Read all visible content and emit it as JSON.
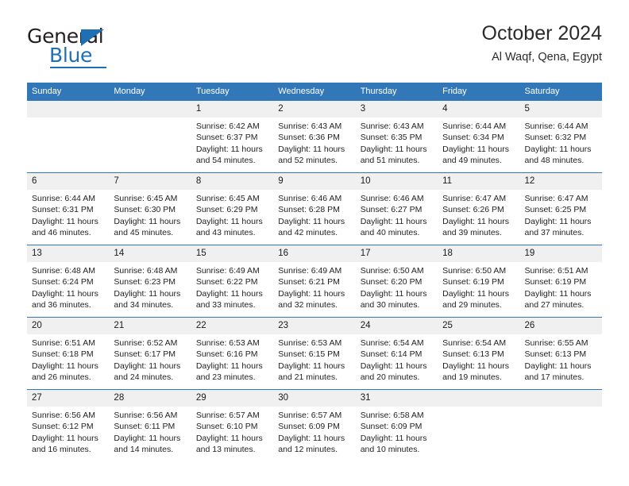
{
  "logo": {
    "word1": "General",
    "word2": "Blue",
    "triangle_color": "#1f6fb5"
  },
  "header": {
    "title": "October 2024",
    "subtitle": "Al Waqf, Qena, Egypt",
    "header_bg": "#3278b8"
  },
  "calendar": {
    "weekday_headers": [
      "Sunday",
      "Monday",
      "Tuesday",
      "Wednesday",
      "Thursday",
      "Friday",
      "Saturday"
    ],
    "labels": {
      "sunrise": "Sunrise:",
      "sunset": "Sunset:",
      "daylight": "Daylight:"
    },
    "weeks": [
      [
        {
          "day": ""
        },
        {
          "day": ""
        },
        {
          "day": "1",
          "sunrise": "Sunrise: 6:42 AM",
          "sunset": "Sunset: 6:37 PM",
          "daylight": "Daylight: 11 hours and 54 minutes."
        },
        {
          "day": "2",
          "sunrise": "Sunrise: 6:43 AM",
          "sunset": "Sunset: 6:36 PM",
          "daylight": "Daylight: 11 hours and 52 minutes."
        },
        {
          "day": "3",
          "sunrise": "Sunrise: 6:43 AM",
          "sunset": "Sunset: 6:35 PM",
          "daylight": "Daylight: 11 hours and 51 minutes."
        },
        {
          "day": "4",
          "sunrise": "Sunrise: 6:44 AM",
          "sunset": "Sunset: 6:34 PM",
          "daylight": "Daylight: 11 hours and 49 minutes."
        },
        {
          "day": "5",
          "sunrise": "Sunrise: 6:44 AM",
          "sunset": "Sunset: 6:32 PM",
          "daylight": "Daylight: 11 hours and 48 minutes."
        }
      ],
      [
        {
          "day": "6",
          "sunrise": "Sunrise: 6:44 AM",
          "sunset": "Sunset: 6:31 PM",
          "daylight": "Daylight: 11 hours and 46 minutes."
        },
        {
          "day": "7",
          "sunrise": "Sunrise: 6:45 AM",
          "sunset": "Sunset: 6:30 PM",
          "daylight": "Daylight: 11 hours and 45 minutes."
        },
        {
          "day": "8",
          "sunrise": "Sunrise: 6:45 AM",
          "sunset": "Sunset: 6:29 PM",
          "daylight": "Daylight: 11 hours and 43 minutes."
        },
        {
          "day": "9",
          "sunrise": "Sunrise: 6:46 AM",
          "sunset": "Sunset: 6:28 PM",
          "daylight": "Daylight: 11 hours and 42 minutes."
        },
        {
          "day": "10",
          "sunrise": "Sunrise: 6:46 AM",
          "sunset": "Sunset: 6:27 PM",
          "daylight": "Daylight: 11 hours and 40 minutes."
        },
        {
          "day": "11",
          "sunrise": "Sunrise: 6:47 AM",
          "sunset": "Sunset: 6:26 PM",
          "daylight": "Daylight: 11 hours and 39 minutes."
        },
        {
          "day": "12",
          "sunrise": "Sunrise: 6:47 AM",
          "sunset": "Sunset: 6:25 PM",
          "daylight": "Daylight: 11 hours and 37 minutes."
        }
      ],
      [
        {
          "day": "13",
          "sunrise": "Sunrise: 6:48 AM",
          "sunset": "Sunset: 6:24 PM",
          "daylight": "Daylight: 11 hours and 36 minutes."
        },
        {
          "day": "14",
          "sunrise": "Sunrise: 6:48 AM",
          "sunset": "Sunset: 6:23 PM",
          "daylight": "Daylight: 11 hours and 34 minutes."
        },
        {
          "day": "15",
          "sunrise": "Sunrise: 6:49 AM",
          "sunset": "Sunset: 6:22 PM",
          "daylight": "Daylight: 11 hours and 33 minutes."
        },
        {
          "day": "16",
          "sunrise": "Sunrise: 6:49 AM",
          "sunset": "Sunset: 6:21 PM",
          "daylight": "Daylight: 11 hours and 32 minutes."
        },
        {
          "day": "17",
          "sunrise": "Sunrise: 6:50 AM",
          "sunset": "Sunset: 6:20 PM",
          "daylight": "Daylight: 11 hours and 30 minutes."
        },
        {
          "day": "18",
          "sunrise": "Sunrise: 6:50 AM",
          "sunset": "Sunset: 6:19 PM",
          "daylight": "Daylight: 11 hours and 29 minutes."
        },
        {
          "day": "19",
          "sunrise": "Sunrise: 6:51 AM",
          "sunset": "Sunset: 6:19 PM",
          "daylight": "Daylight: 11 hours and 27 minutes."
        }
      ],
      [
        {
          "day": "20",
          "sunrise": "Sunrise: 6:51 AM",
          "sunset": "Sunset: 6:18 PM",
          "daylight": "Daylight: 11 hours and 26 minutes."
        },
        {
          "day": "21",
          "sunrise": "Sunrise: 6:52 AM",
          "sunset": "Sunset: 6:17 PM",
          "daylight": "Daylight: 11 hours and 24 minutes."
        },
        {
          "day": "22",
          "sunrise": "Sunrise: 6:53 AM",
          "sunset": "Sunset: 6:16 PM",
          "daylight": "Daylight: 11 hours and 23 minutes."
        },
        {
          "day": "23",
          "sunrise": "Sunrise: 6:53 AM",
          "sunset": "Sunset: 6:15 PM",
          "daylight": "Daylight: 11 hours and 21 minutes."
        },
        {
          "day": "24",
          "sunrise": "Sunrise: 6:54 AM",
          "sunset": "Sunset: 6:14 PM",
          "daylight": "Daylight: 11 hours and 20 minutes."
        },
        {
          "day": "25",
          "sunrise": "Sunrise: 6:54 AM",
          "sunset": "Sunset: 6:13 PM",
          "daylight": "Daylight: 11 hours and 19 minutes."
        },
        {
          "day": "26",
          "sunrise": "Sunrise: 6:55 AM",
          "sunset": "Sunset: 6:13 PM",
          "daylight": "Daylight: 11 hours and 17 minutes."
        }
      ],
      [
        {
          "day": "27",
          "sunrise": "Sunrise: 6:56 AM",
          "sunset": "Sunset: 6:12 PM",
          "daylight": "Daylight: 11 hours and 16 minutes."
        },
        {
          "day": "28",
          "sunrise": "Sunrise: 6:56 AM",
          "sunset": "Sunset: 6:11 PM",
          "daylight": "Daylight: 11 hours and 14 minutes."
        },
        {
          "day": "29",
          "sunrise": "Sunrise: 6:57 AM",
          "sunset": "Sunset: 6:10 PM",
          "daylight": "Daylight: 11 hours and 13 minutes."
        },
        {
          "day": "30",
          "sunrise": "Sunrise: 6:57 AM",
          "sunset": "Sunset: 6:09 PM",
          "daylight": "Daylight: 11 hours and 12 minutes."
        },
        {
          "day": "31",
          "sunrise": "Sunrise: 6:58 AM",
          "sunset": "Sunset: 6:09 PM",
          "daylight": "Daylight: 11 hours and 10 minutes."
        },
        {
          "day": ""
        },
        {
          "day": ""
        }
      ]
    ]
  }
}
